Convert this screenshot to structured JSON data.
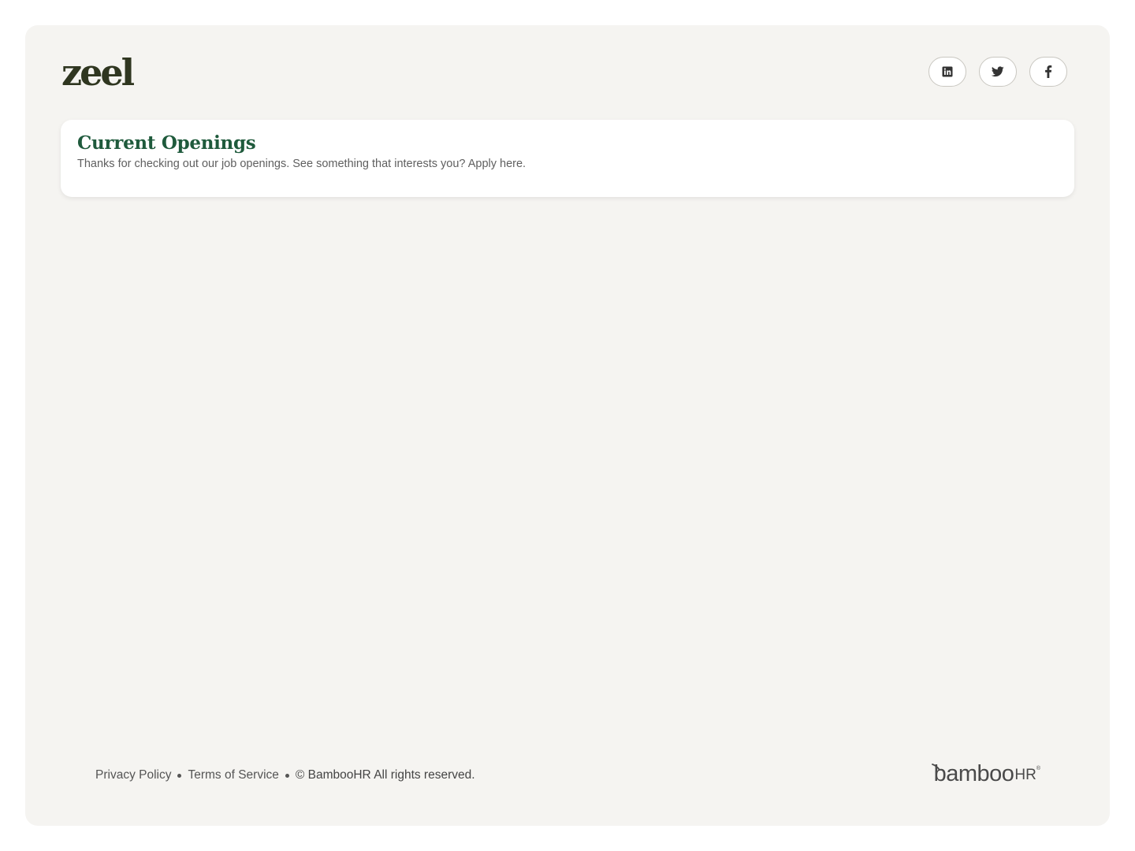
{
  "brand": {
    "logo_text": "zeel",
    "logo_color": "#2f3620"
  },
  "socials": [
    {
      "name": "linkedin",
      "icon": "linkedin-icon"
    },
    {
      "name": "twitter",
      "icon": "twitter-icon"
    },
    {
      "name": "facebook",
      "icon": "facebook-icon"
    }
  ],
  "openings": {
    "title": "Current Openings",
    "subtitle": "Thanks for checking out our job openings. See something that interests you? Apply here.",
    "title_color": "#1f5a3c"
  },
  "footer": {
    "privacy_label": "Privacy Policy",
    "terms_label": "Terms of Service",
    "copyright": "© BambooHR All rights reserved.",
    "powered_by_main": "bamboo",
    "powered_by_hr": "HR",
    "powered_by_reg": "®"
  },
  "colors": {
    "page_bg": "#f5f4f1",
    "card_bg": "#ffffff",
    "text_muted": "#5f5f5f"
  }
}
